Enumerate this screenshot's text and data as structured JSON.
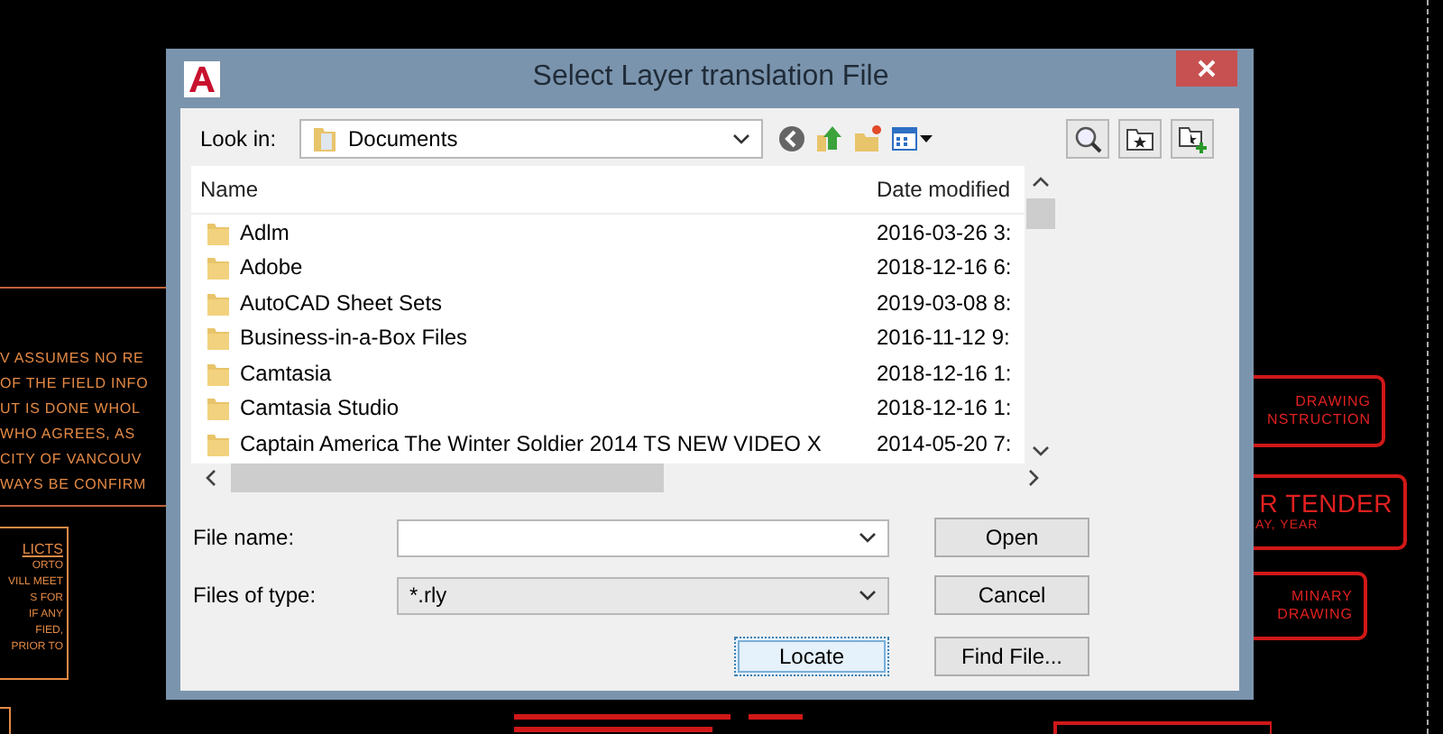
{
  "background_drawing": {
    "notes": [
      "V ASSUMES NO RE",
      "OF THE FIELD INFO",
      "UT IS DONE WHOL",
      "WHO AGREES, AS",
      "CITY OF VANCOUV",
      "WAYS BE CONFIRM"
    ],
    "conflicts_box": {
      "heading": "LICTS",
      "lines": [
        "ORTO",
        "VILL MEET",
        "S FOR",
        "IF ANY",
        "FIED,",
        "PRIOR TO"
      ]
    },
    "title_blocks": [
      {
        "lines": [
          "DRAWING",
          "NSTRUCTION"
        ]
      },
      {
        "lines": [
          "R TENDER",
          "AY, YEAR"
        ]
      },
      {
        "lines": [
          "MINARY",
          "DRAWING"
        ]
      }
    ]
  },
  "dialog": {
    "title": "Select Layer translation File",
    "look_in": {
      "label": "Look in:",
      "value": "Documents"
    },
    "columns": [
      "Name",
      "Date modified"
    ],
    "files": [
      {
        "name": "Adlm",
        "date": "2016-03-26 3:"
      },
      {
        "name": "Adobe",
        "date": "2018-12-16 6:"
      },
      {
        "name": "AutoCAD Sheet Sets",
        "date": "2019-03-08 8:"
      },
      {
        "name": "Business-in-a-Box Files",
        "date": "2016-11-12 9:"
      },
      {
        "name": "Camtasia",
        "date": "2018-12-16 1:"
      },
      {
        "name": "Camtasia Studio",
        "date": "2018-12-16 1:"
      },
      {
        "name": "Captain America The Winter Soldier 2014 TS NEW VIDEO X",
        "date": "2014-05-20 7:"
      }
    ],
    "file_name": {
      "label": "File name:"
    },
    "file_type": {
      "label": "Files of type:",
      "value": "*.rly"
    },
    "side_buttons": [
      {
        "label": "Open",
        "focused": false
      },
      {
        "label": "Cancel",
        "focused": false
      }
    ],
    "bottom_buttons": [
      {
        "label": "Locate",
        "focused": true
      },
      {
        "label": "Find File...",
        "focused": false
      }
    ]
  }
}
